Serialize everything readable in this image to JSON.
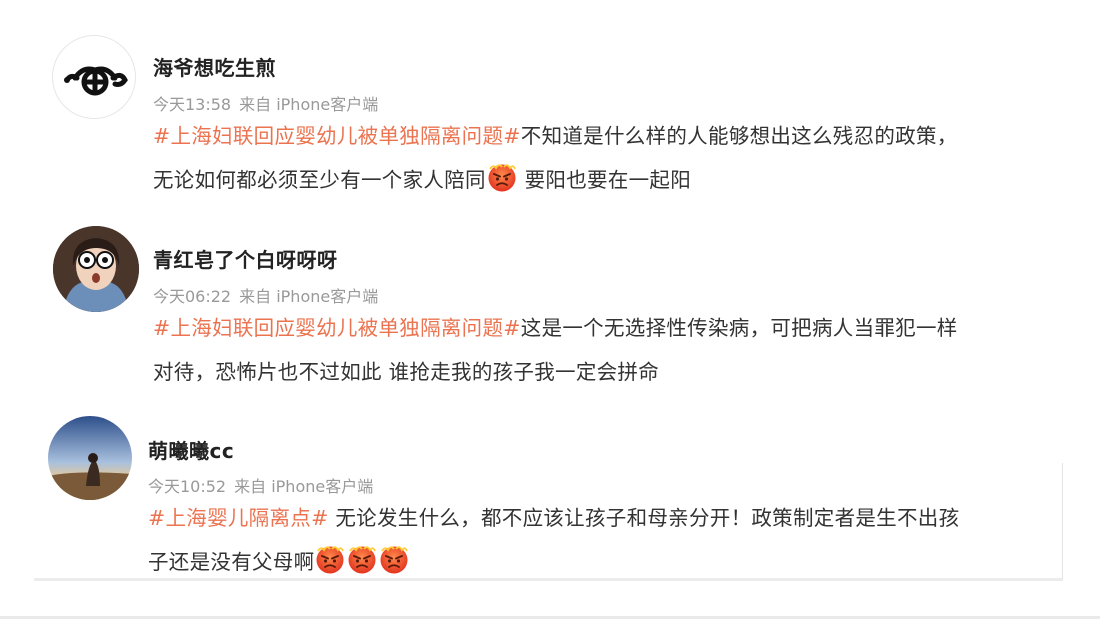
{
  "posts": [
    {
      "username": "海爷想吃生煎",
      "time": "今天13:58",
      "source": "来自 iPhone客户端",
      "hashtag": "#上海妇联回应婴幼儿被单独隔离问题#",
      "line1_text": "不知道是什么样的人能够想出这么残忍的政策，",
      "line2_text": "无论如何都必须至少有一个家人陪同",
      "line2_after_emoji": " 要阳也要在一起阳",
      "emoji_icon": "angry-face-icon"
    },
    {
      "username": "青红皂了个白呀呀呀",
      "time": "今天06:22",
      "source": "来自 iPhone客户端",
      "hashtag": "#上海妇联回应婴幼儿被单独隔离问题#",
      "line1_text": "这是一个无选择性传染病，可把病人当罪犯一样",
      "line2_text": "对待，恐怖片也不过如此 谁抢走我的孩子我一定会拼命"
    },
    {
      "username": "萌曦曦cc",
      "time": "今天10:52",
      "source": "来自 iPhone客户端",
      "hashtag": "#上海婴儿隔离点#",
      "line1_text": " 无论发生什么，都不应该让孩子和母亲分开！政策制定者是生不出孩",
      "line2_text": "子还是没有父母啊",
      "emoji_icon": "angry-face-icon"
    }
  ],
  "colors": {
    "hashtag": "#eb7350",
    "text": "#333333",
    "meta": "#999999"
  }
}
